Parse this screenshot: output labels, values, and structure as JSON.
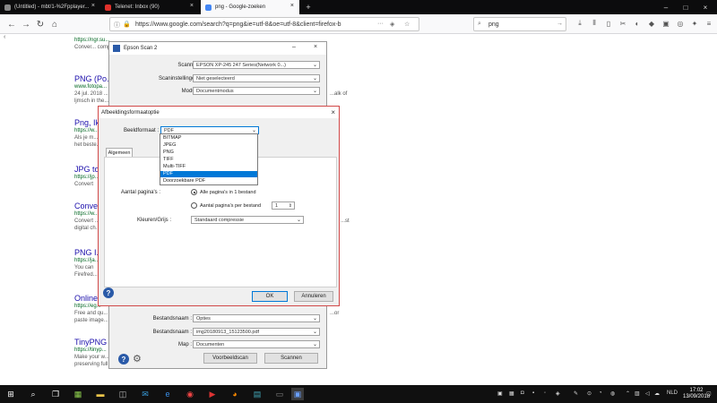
{
  "browser": {
    "tabs": [
      {
        "label": "(Untitled) - mbt/1-%2Fpplayer..."
      },
      {
        "label": "Telenet: Inbox (90)"
      },
      {
        "label": "png - Google-zoeken"
      }
    ],
    "url": "https://www.google.com/search?q=png&ie=utf-8&oe=utf-8&client=firefox-b",
    "search_value": "png"
  },
  "results": [
    {
      "title": "",
      "url": "https://ngr.su...",
      "desc": "Conver... compressie..."
    },
    {
      "title": "PNG (Po...",
      "url": "www.fotopa...",
      "desc": "24 jul. 2018 ...",
      "desc2": "ljmsch in the..."
    },
    {
      "title": "Png, Ik...",
      "url": "https://w...",
      "desc": "Als je m...",
      "desc2": "het beste..."
    },
    {
      "title": "JPG to",
      "url": "https://jp...",
      "desc": "Convert"
    },
    {
      "title": "Conve...",
      "url": "https://w...",
      "desc": "Convert ...",
      "desc2": "digital ch..."
    },
    {
      "title": "PNG I...",
      "url": "https://ja...",
      "desc": "You can",
      "desc2": "Firefred..."
    },
    {
      "title": "Online",
      "url": "https://eg...",
      "desc": "Free and qu...",
      "desc2": "paste image..."
    },
    {
      "title": "TinyPNG",
      "url": "https://tinyp...",
      "desc": "Make your w...",
      "desc2": "preserving full transparency..."
    }
  ],
  "results_side": [
    "...alk of",
    "...st",
    "...or"
  ],
  "epson": {
    "title": "Epson Scan 2",
    "fields": [
      {
        "label": "Scanner :",
        "value": "EPSON XP-245 247 Series(Network 0...)"
      },
      {
        "label": "Scaninstellingen :",
        "value": "Niet geselecteerd"
      },
      {
        "label": "Modus :",
        "value": "Documentmodus"
      }
    ],
    "bottom_fields": [
      {
        "label": "Bestandsnaam :",
        "value": "Opties"
      },
      {
        "label": "Bestandsnaam :",
        "value": "img20180913_15123500.pdf"
      },
      {
        "label": "Map :",
        "value": "Documenten"
      }
    ],
    "preview_button": "Voorbeeldscan",
    "scan_button": "Scannen"
  },
  "dialog": {
    "title": "Afbeeldingsformaatoptie",
    "format_label": "Beeldformaat :",
    "format_value": "PDF",
    "tab_label": "Algemeen",
    "options": [
      "BITMAP",
      "JPEG",
      "PNG",
      "TIFF",
      "Multi-TIFF",
      "PDF",
      "Doorzoekbare PDF"
    ],
    "selected_option": "PDF",
    "pages_label": "Aantal pagina's :",
    "radio1": "Alle pagina's in 1 bestand",
    "radio2": "Aantal pagina's per bestand",
    "stepper_value": "1",
    "compression_label": "Kleuren/Grijs :",
    "compression_value": "Standaard compressie",
    "ok_button": "OK",
    "cancel_button": "Annuleren"
  },
  "taskbar": {
    "time": "17:02",
    "date": "13/09/2018",
    "lang": "NLD"
  }
}
